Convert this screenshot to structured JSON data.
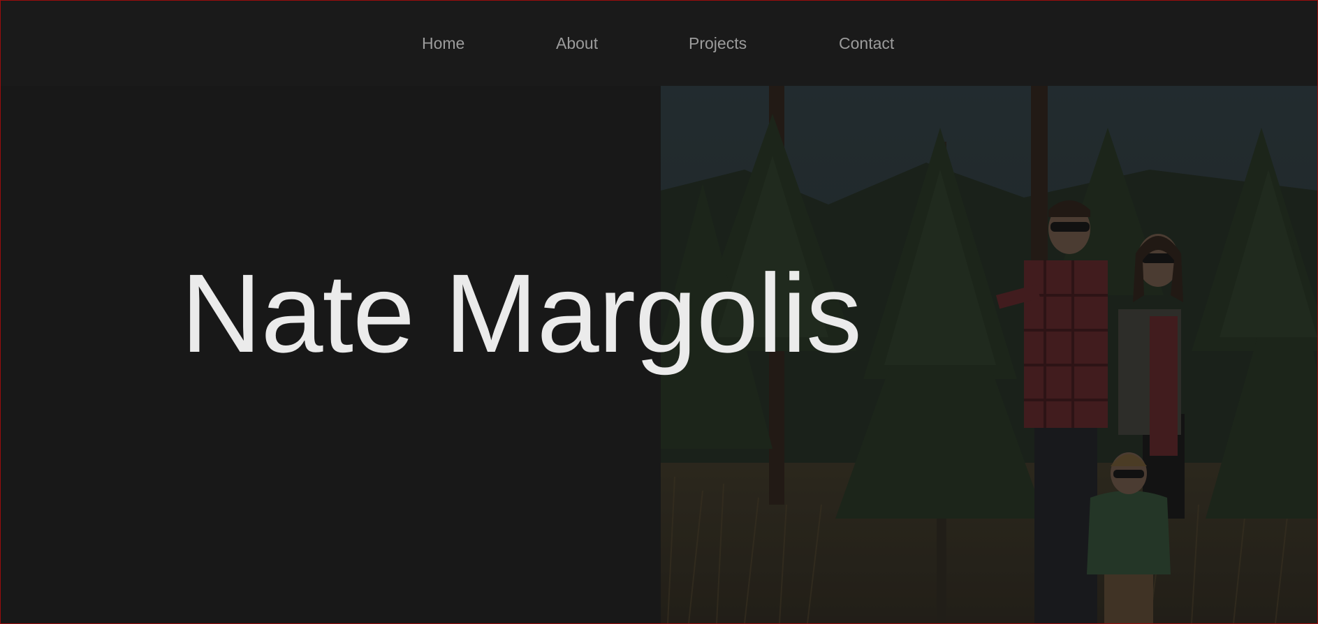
{
  "nav": {
    "items": [
      {
        "label": "Home"
      },
      {
        "label": "About"
      },
      {
        "label": "Projects"
      },
      {
        "label": "Contact"
      }
    ]
  },
  "hero": {
    "title": "Nate Margolis",
    "photo_icon": "family-photo"
  },
  "colors": {
    "background": "#181818",
    "nav_text": "#9c9c9c",
    "title_text": "#ebebeb",
    "frame_border": "#9b0d0d"
  }
}
